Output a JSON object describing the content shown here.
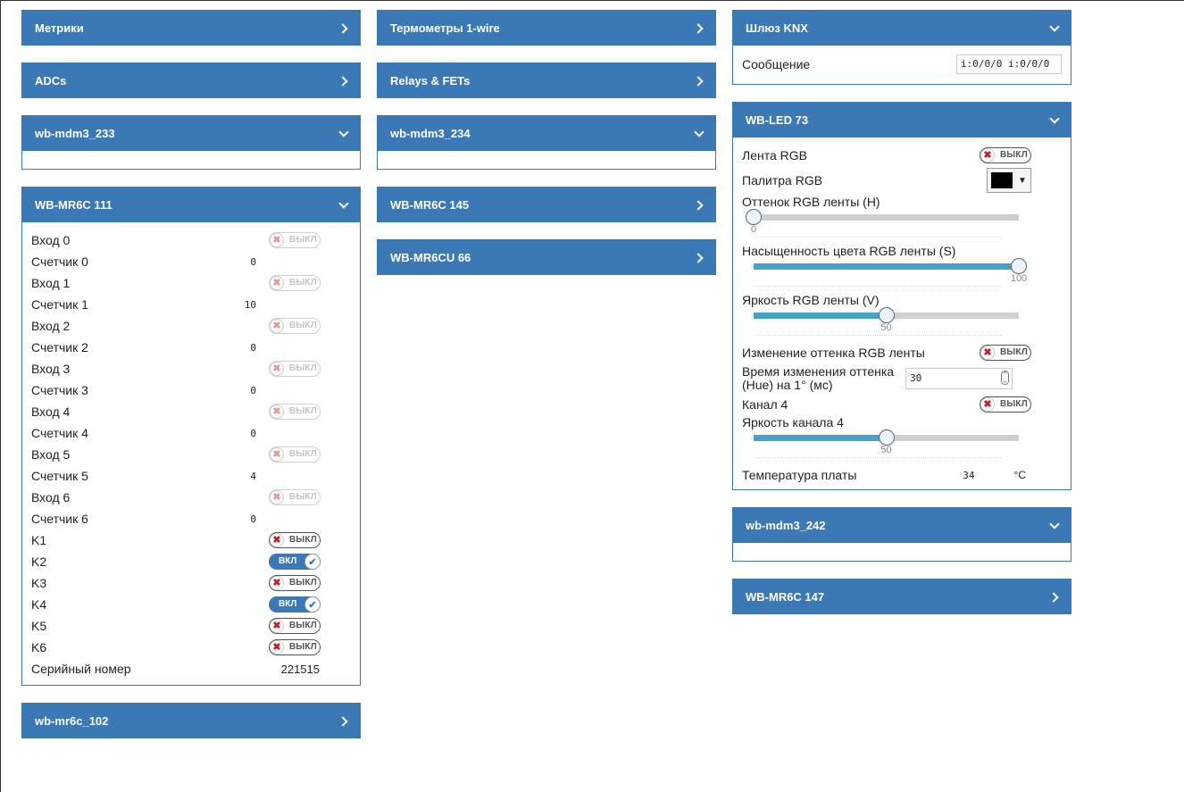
{
  "col1": {
    "metrics": {
      "title": "Метрики"
    },
    "adcs": {
      "title": "ADCs"
    },
    "mdm233": {
      "title": "wb-mdm3_233"
    },
    "mr6c111": {
      "title": "WB-MR6C 111",
      "rows": [
        {
          "label": "Вход 0",
          "switch": "ВЫКЛ"
        },
        {
          "label": "Счетчик 0",
          "value": "0"
        },
        {
          "label": "Вход 1",
          "switch": "ВЫКЛ"
        },
        {
          "label": "Счетчик 1",
          "value": "10"
        },
        {
          "label": "Вход 2",
          "switch": "ВЫКЛ"
        },
        {
          "label": "Счетчик 2",
          "value": "0"
        },
        {
          "label": "Вход 3",
          "switch": "ВЫКЛ"
        },
        {
          "label": "Счетчик 3",
          "value": "0"
        },
        {
          "label": "Вход 4",
          "switch": "ВЫКЛ"
        },
        {
          "label": "Счетчик 4",
          "value": "0"
        },
        {
          "label": "Вход 5",
          "switch": "ВЫКЛ"
        },
        {
          "label": "Счетчик 5",
          "value": "4"
        },
        {
          "label": "Вход 6",
          "switch": "ВЫКЛ"
        },
        {
          "label": "Счетчик 6",
          "value": "0"
        },
        {
          "label": "K1",
          "switch": "ВЫКЛ"
        },
        {
          "label": "K2",
          "switch": "ВКЛ"
        },
        {
          "label": "K3",
          "switch": "ВЫКЛ"
        },
        {
          "label": "K4",
          "switch": "ВКЛ"
        },
        {
          "label": "K5",
          "switch": "ВЫКЛ"
        },
        {
          "label": "K6",
          "switch": "ВЫКЛ"
        },
        {
          "label": "Серийный номер",
          "value": "221515"
        }
      ]
    },
    "mr6c102": {
      "title": "wb-mr6c_102"
    }
  },
  "col2": {
    "thermo": {
      "title": "Термометры 1-wire"
    },
    "relays": {
      "title": "Relays & FETs"
    },
    "mdm234": {
      "title": "wb-mdm3_234"
    },
    "mr6c145": {
      "title": "WB-MR6C 145"
    },
    "mr6cu66": {
      "title": "WB-MR6CU 66"
    }
  },
  "col3": {
    "knx": {
      "title": "Шлюз KNX",
      "message_label": "Сообщение",
      "message_value": "i:0/0/0 i:0/0/0"
    },
    "led73": {
      "title": "WB-LED 73",
      "rgb_strip": {
        "label": "Лента RGB",
        "switch": "ВЫКЛ"
      },
      "rgb_palette": {
        "label": "Палитра RGB",
        "color": "#000000"
      },
      "hue": {
        "label": "Оттенок RGB ленты (H)",
        "value": "0",
        "fraction": 0
      },
      "saturation": {
        "label": "Насыщенность цвета RGB ленты (S)",
        "value": "100",
        "fraction": 1
      },
      "brightness": {
        "label": "Яркость RGB ленты (V)",
        "value": "50",
        "fraction": 0.5
      },
      "hue_change": {
        "label": "Изменение оттенка RGB ленты",
        "switch": "ВЫКЛ"
      },
      "hue_time": {
        "label_line1": "Время изменения оттенка",
        "label_line2": "(Hue) на 1° (мс)",
        "value": "30"
      },
      "channel4": {
        "label": "Канал 4",
        "switch": "ВЫКЛ"
      },
      "channel4_brightness": {
        "label": "Яркость канала 4",
        "value": "50",
        "fraction": 0.5
      },
      "board_temp": {
        "label": "Температура платы",
        "value": "34",
        "unit": "°C"
      }
    },
    "mdm242": {
      "title": "wb-mdm3_242"
    },
    "mr6c147": {
      "title": "WB-MR6C 147"
    }
  }
}
